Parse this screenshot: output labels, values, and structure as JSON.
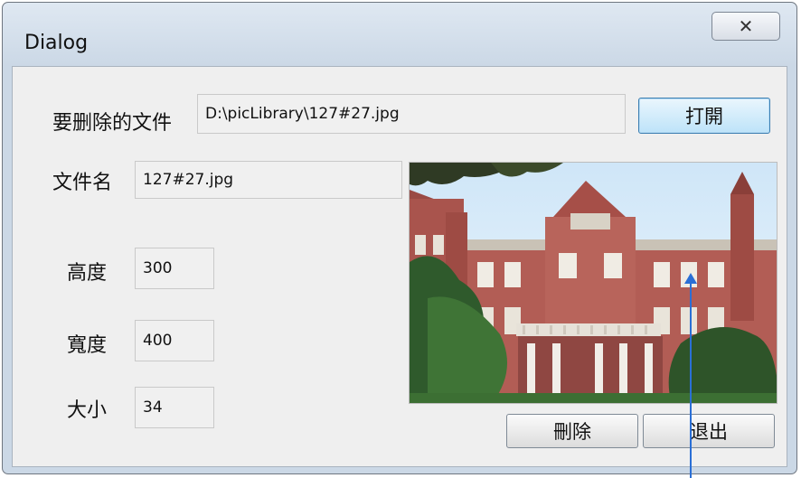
{
  "window": {
    "title": "Dialog",
    "close_glyph": "✕"
  },
  "form": {
    "file_to_delete_label": "要删除的文件",
    "file_path": "D:\\picLibrary\\127#27.jpg",
    "open_button": "打開",
    "file_name_label": "文件名",
    "file_name": "127#27.jpg",
    "height_label": "高度",
    "height_value": "300",
    "width_label": "寬度",
    "width_value": "400",
    "size_label": "大小",
    "size_value": "34"
  },
  "actions": {
    "delete_button": "刪除",
    "exit_button": "退出"
  },
  "colors": {
    "accent_arrow": "#2a6fd6"
  },
  "icons": {
    "close": "close-icon",
    "pointer": "arrow-up-icon"
  }
}
